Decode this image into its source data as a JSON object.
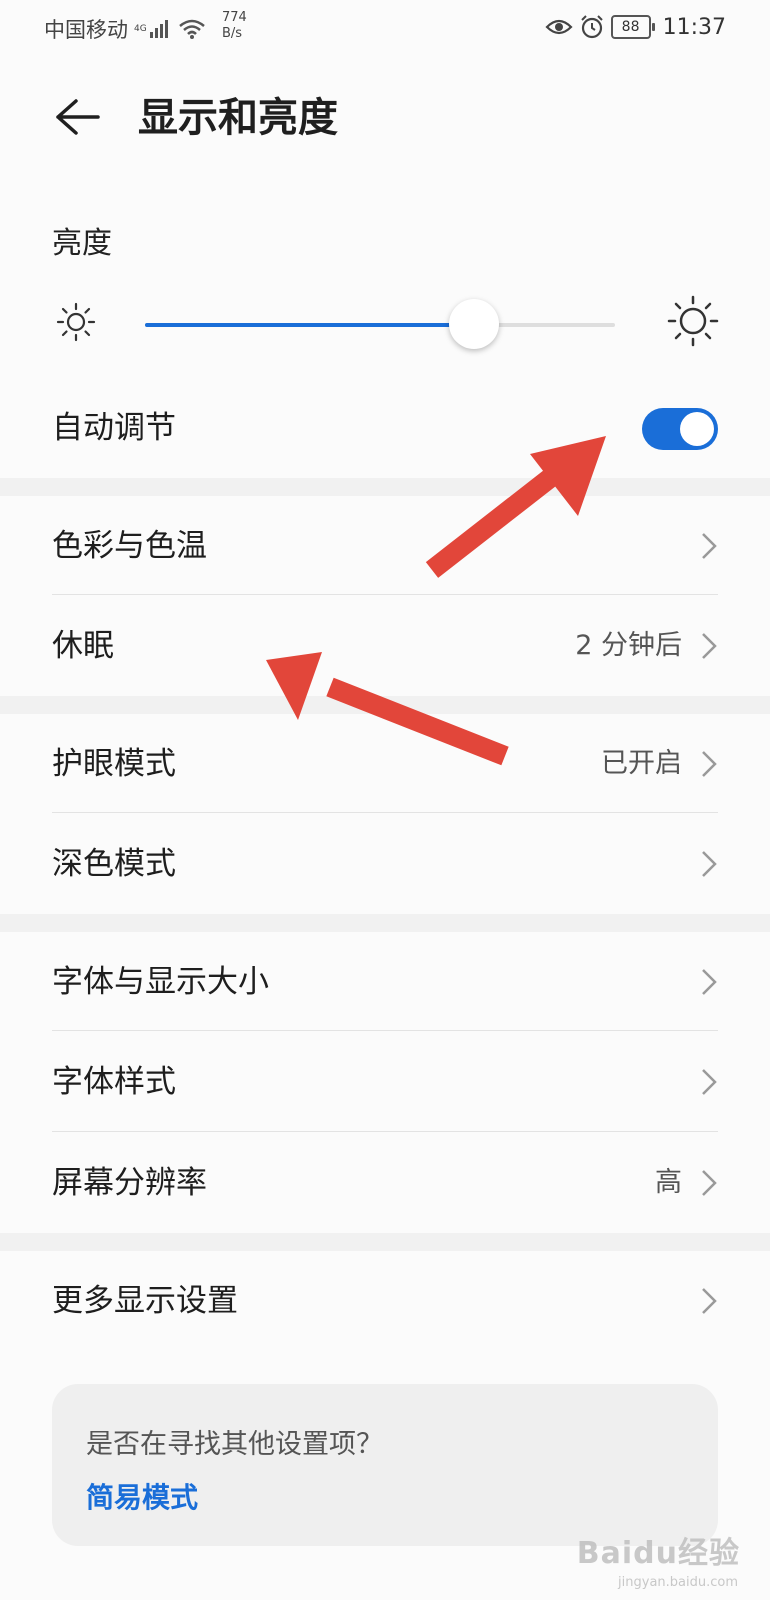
{
  "status_bar": {
    "carrier": "中国移动",
    "network": "4G",
    "speed_value": "774",
    "speed_unit": "B/s",
    "battery": "88",
    "time": "11:37",
    "icons": [
      "signal-icon",
      "wifi-icon",
      "eye-icon",
      "alarm-icon",
      "battery-icon"
    ]
  },
  "header": {
    "back_icon": "back-arrow-icon",
    "title": "显示和亮度"
  },
  "brightness": {
    "label": "亮度",
    "level_fraction": 0.7,
    "icons": [
      "sun-small-icon",
      "sun-large-icon"
    ]
  },
  "auto_adjust": {
    "label": "自动调节",
    "enabled": true
  },
  "rows": {
    "color_temp": {
      "label": "色彩与色温",
      "value": ""
    },
    "sleep": {
      "label": "休眠",
      "value": "2 分钟后"
    },
    "eye_comfort": {
      "label": "护眼模式",
      "value": "已开启"
    },
    "dark_mode": {
      "label": "深色模式",
      "value": ""
    },
    "font_size": {
      "label": "字体与显示大小",
      "value": ""
    },
    "font_style": {
      "label": "字体样式",
      "value": ""
    },
    "resolution": {
      "label": "屏幕分辨率",
      "value": "高"
    },
    "more": {
      "label": "更多显示设置",
      "value": ""
    }
  },
  "tip": {
    "question": "是否在寻找其他设置项？",
    "link": "简易模式"
  },
  "watermark": {
    "brand": "Baidu经验",
    "url": "jingyan.baidu.com"
  },
  "colors": {
    "accent": "#1a6ed8",
    "annotation_arrow": "#e2463a"
  }
}
